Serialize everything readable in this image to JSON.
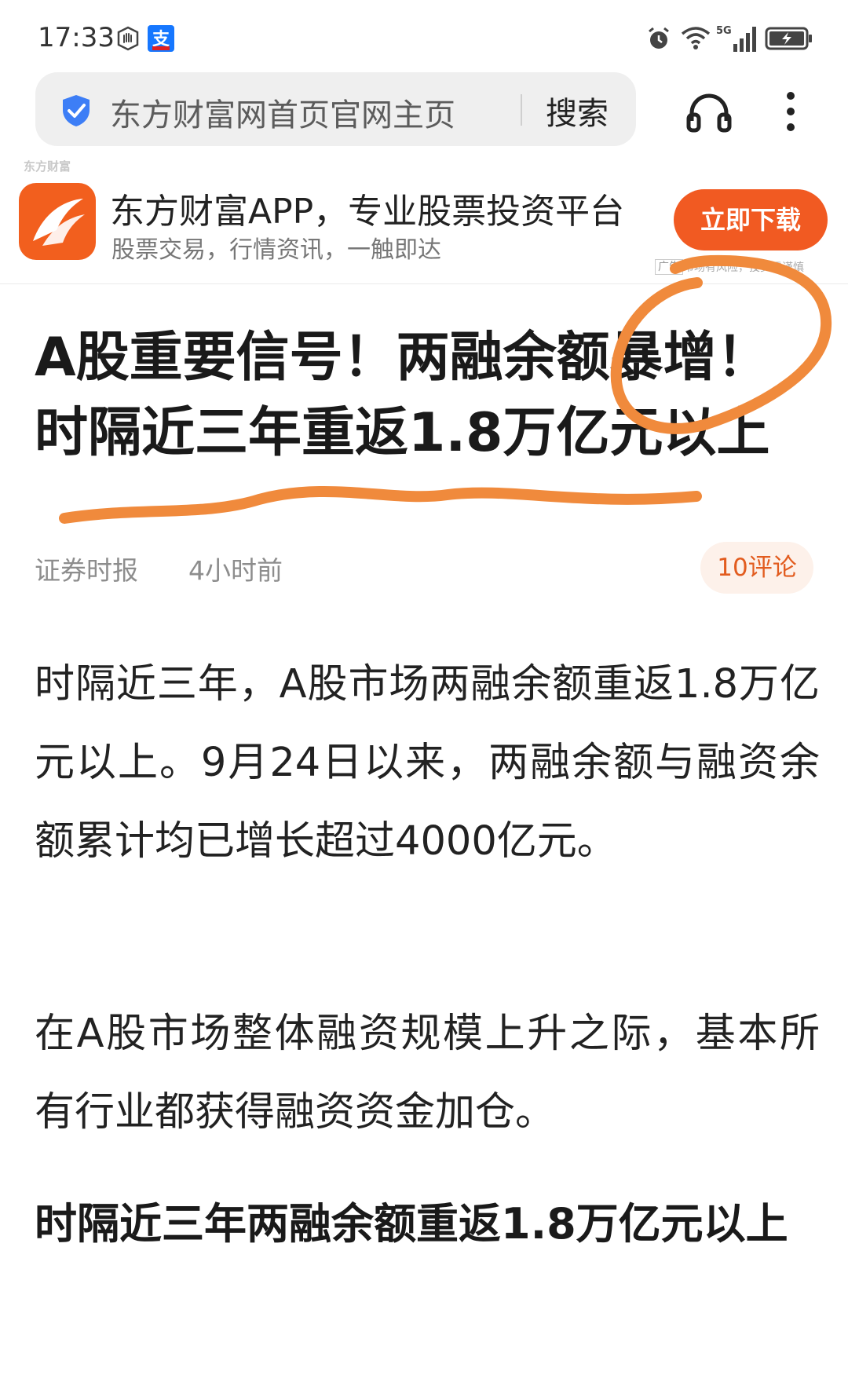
{
  "status_bar": {
    "time": "17:33",
    "network": "5G"
  },
  "search": {
    "query": "东方财富网首页官网主页",
    "button_label": "搜索"
  },
  "ad": {
    "brand_mini": "东方财富",
    "title": "东方财富APP，专业股票投资平台",
    "subtitle": "股票交易，行情资讯，一触即达",
    "cta_label": "立即下载",
    "tag": "广告",
    "disclaimer": "市场有风险，投资需谨慎"
  },
  "article": {
    "headline": "A股重要信号！两融余额暴增！时隔近三年重返1.8万亿元以上",
    "source": "证券时报",
    "time_ago": "4小时前",
    "comments": "10评论",
    "paragraphs": [
      "时隔近三年，A股市场两融余额重返1.8万亿元以上。9月24日以来，两融余额与融资余额累计均已增长超过4000亿元。",
      "在A股市场整体融资规模上升之际，基本所有行业都获得融资资金加仓。"
    ],
    "subheading": "时隔近三年两融余额重返1.8万亿元以上"
  },
  "colors": {
    "accent": "#f15a22",
    "annotation": "#f08a3c",
    "shield": "#3d7ef6"
  }
}
